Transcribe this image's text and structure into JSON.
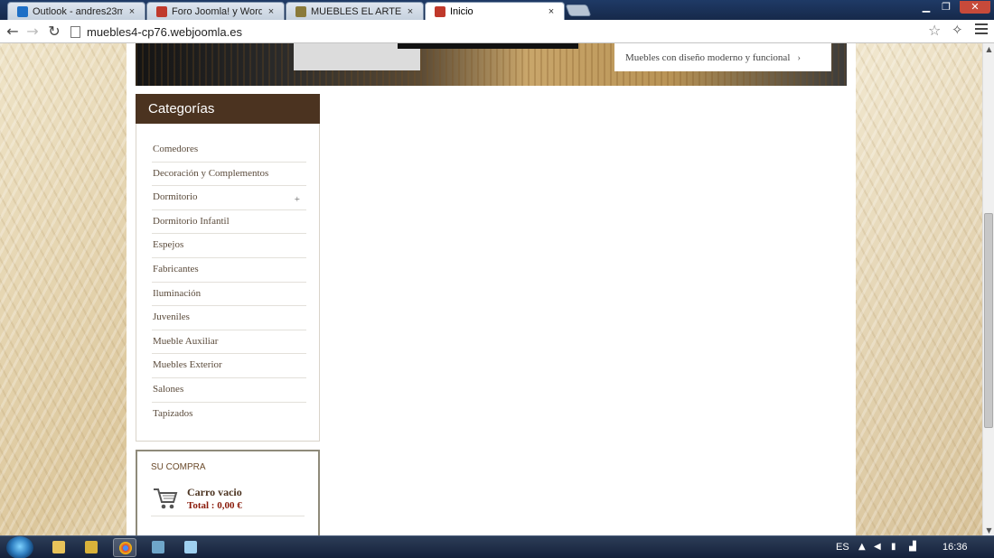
{
  "browser": {
    "tabs": [
      {
        "label": "Outlook - andres23mf@h",
        "favicon_color": "#1e6fc6"
      },
      {
        "label": "Foro Joomla! y WordPress",
        "favicon_color": "#c0392b"
      },
      {
        "label": "MUEBLES EL ARTESANO -",
        "favicon_color": "#8a7a3a"
      },
      {
        "label": "Inicio",
        "favicon_color": "#c0392b"
      }
    ],
    "tab_close": "×",
    "url": "muebles4-cp76.webjoomla.es"
  },
  "hero": {
    "caption": "Muebles con diseño moderno y funcional"
  },
  "categories": {
    "title": "Categorías",
    "items": [
      {
        "label": "Comedores"
      },
      {
        "label": "Decoración y Complementos"
      },
      {
        "label": "Dormitorio"
      },
      {
        "label": "Dormitorio Infantil"
      },
      {
        "label": "Espejos"
      },
      {
        "label": "Fabricantes"
      },
      {
        "label": "Iluminación"
      },
      {
        "label": "Juveniles"
      },
      {
        "label": "Mueble Auxiliar"
      },
      {
        "label": "Muebles Exterior"
      },
      {
        "label": "Salones"
      },
      {
        "label": "Tapizados"
      }
    ],
    "expand_glyph": "+"
  },
  "cart": {
    "title": "SU COMPRA",
    "status": "Carro vacio",
    "total": "Total : 0,00 €"
  },
  "taskbar": {
    "language": "ES",
    "clock": "16:36"
  },
  "colors": {
    "category_header_bg": "#4b3320",
    "cart_total": "#8a1a0a"
  }
}
